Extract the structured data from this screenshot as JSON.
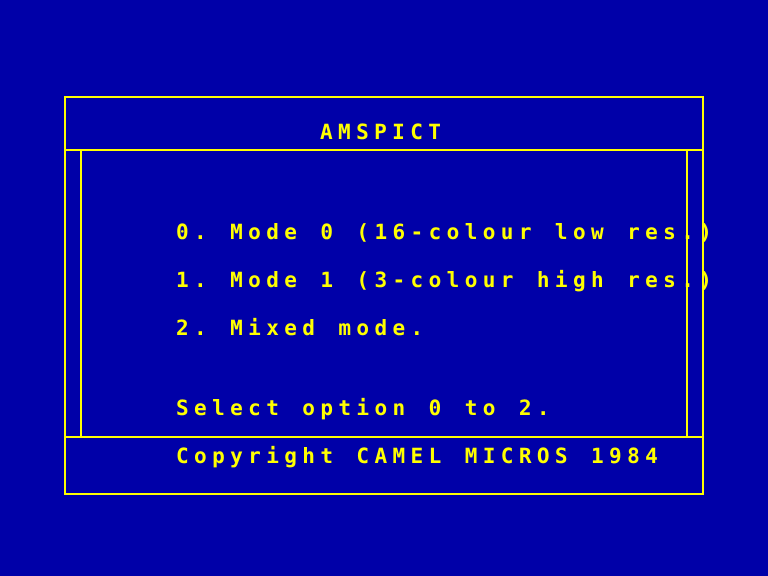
{
  "screen": {
    "background_color": "#0000a8",
    "foreground_color": "#ffff00"
  },
  "header": {
    "title": "AMSPICT"
  },
  "menu": {
    "options": [
      {
        "key": "0",
        "label": "0. Mode 0 (16-colour low res.)"
      },
      {
        "key": "1",
        "label": "1. Mode 1 (3-colour high res.)"
      },
      {
        "key": "2",
        "label": "2. Mixed mode."
      }
    ],
    "prompt": "Select option 0 to 2."
  },
  "footer": {
    "copyright": "Copyright CAMEL MICROS 1984"
  }
}
